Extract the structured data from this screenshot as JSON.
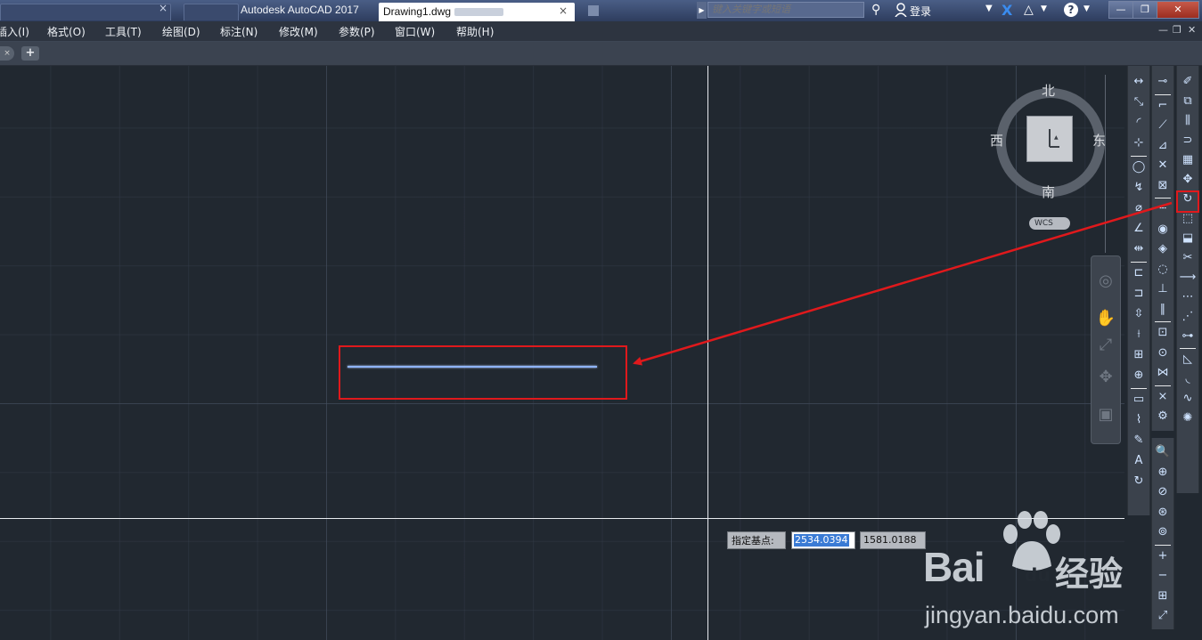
{
  "title_bar": {
    "app_title": "Autodesk AutoCAD 2017",
    "document_tab": "Drawing1.dwg",
    "close_glyph": "×",
    "search_placeholder": "键入关键字或短语",
    "login_label": "登录",
    "help_label": "?",
    "window_buttons": [
      "—",
      "❐",
      "✕"
    ]
  },
  "menu_bar": {
    "items": [
      "插入(I)",
      "格式(O)",
      "工具(T)",
      "绘图(D)",
      "标注(N)",
      "修改(M)",
      "参数(P)",
      "窗口(W)",
      "帮助(H)"
    ],
    "mdi_buttons": [
      "—",
      "❐",
      "✕"
    ]
  },
  "tab_bar": {
    "new_tab_label": "+"
  },
  "viewcube": {
    "north": "北",
    "south": "南",
    "west": "西",
    "east": "东",
    "coordinate_system": "WCS"
  },
  "dynamic_input": {
    "prompt": "指定基点:",
    "x_value": "2534.0394",
    "y_value": "1581.0188"
  },
  "watermark": {
    "brand_latin": "Bai",
    "brand_du": "du",
    "brand_cn": "经验",
    "url": "jingyan.baidu.com"
  },
  "toolbars": {
    "dimension": [
      "linear-dim",
      "aligned-dim",
      "arc-length-dim",
      "ordinate-dim",
      "radius-dim",
      "jogged-dim",
      "diameter-dim",
      "angular-dim",
      "quick-dim",
      "baseline-dim",
      "continue-dim",
      "dim-space",
      "dim-break",
      "tolerance",
      "center-mark",
      "inspection",
      "jogged-linear",
      "dim-edit",
      "dim-text-edit",
      "dim-update"
    ],
    "object_snap": [
      "temp-track",
      "snap-from",
      "snap-endpoint",
      "snap-midpoint",
      "snap-intersection",
      "snap-apparent",
      "snap-extension",
      "snap-center",
      "snap-quadrant",
      "snap-tangent",
      "snap-perpendicular",
      "snap-parallel",
      "snap-insert",
      "snap-node",
      "snap-nearest",
      "snap-none",
      "osnap-settings"
    ],
    "zoom": [
      "zoom-window",
      "zoom-dynamic",
      "zoom-scale",
      "zoom-center",
      "zoom-object",
      "zoom-in",
      "zoom-out",
      "zoom-all",
      "zoom-extents"
    ],
    "modify": [
      "erase",
      "copy",
      "mirror",
      "offset",
      "array",
      "move",
      "rotate",
      "scale",
      "stretch",
      "trim",
      "extend",
      "break-at-point",
      "break",
      "join",
      "chamfer",
      "fillet",
      "blend-curves",
      "explode"
    ]
  },
  "colors": {
    "canvas": "#212830",
    "entity_line": "#8fb4ff",
    "annotation_red": "#e0191c",
    "crosshair": "#e8ebef"
  }
}
